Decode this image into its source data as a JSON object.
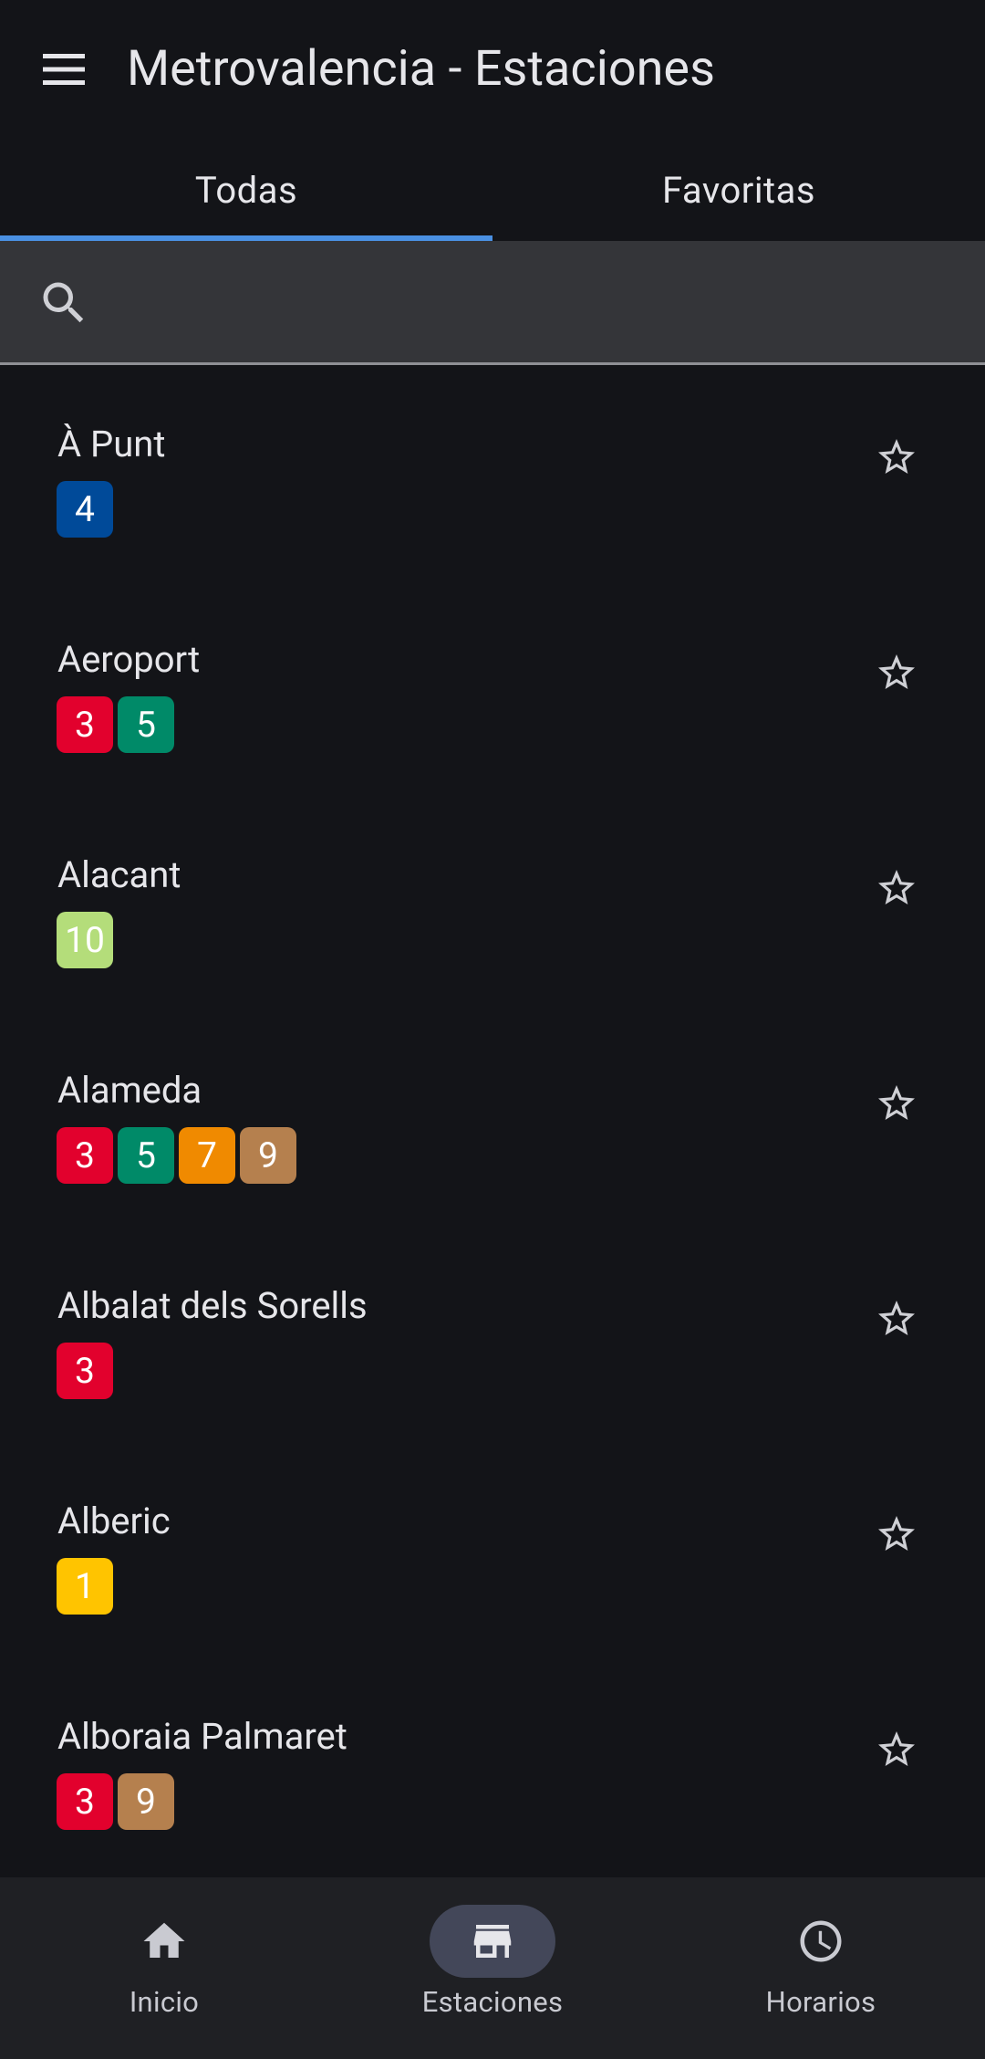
{
  "app_bar": {
    "title": "Metrovalencia - Estaciones",
    "menu_icon": "menu-icon"
  },
  "tabs": [
    {
      "label": "Todas",
      "active": true
    },
    {
      "label": "Favoritas",
      "active": false
    }
  ],
  "search": {
    "placeholder": "",
    "value": "",
    "icon": "search-icon"
  },
  "line_colors": {
    "1": "#ffc400",
    "3": "#e2012d",
    "4": "#004a99",
    "5": "#008a68",
    "7": "#f08a00",
    "9": "#b5804e",
    "10": "#b4dd7a"
  },
  "stations": [
    {
      "name": "À Punt",
      "lines": [
        "4"
      ],
      "favorite": false
    },
    {
      "name": "Aeroport",
      "lines": [
        "3",
        "5"
      ],
      "favorite": false
    },
    {
      "name": "Alacant",
      "lines": [
        "10"
      ],
      "favorite": false
    },
    {
      "name": "Alameda",
      "lines": [
        "3",
        "5",
        "7",
        "9"
      ],
      "favorite": false
    },
    {
      "name": "Albalat dels Sorells",
      "lines": [
        "3"
      ],
      "favorite": false
    },
    {
      "name": "Alberic",
      "lines": [
        "1"
      ],
      "favorite": false
    },
    {
      "name": "Alboraia Palmaret",
      "lines": [
        "3",
        "9"
      ],
      "favorite": false
    }
  ],
  "bottom_nav": [
    {
      "label": "Inicio",
      "icon": "home-icon",
      "active": false
    },
    {
      "label": "Estaciones",
      "icon": "store-icon",
      "active": true
    },
    {
      "label": "Horarios",
      "icon": "clock-icon",
      "active": false
    }
  ],
  "colors": {
    "background": "#131418",
    "tab_indicator": "#4a90e2",
    "search_bg": "#343539",
    "nav_bg": "#1f2024",
    "nav_active_pill": "#434759"
  }
}
